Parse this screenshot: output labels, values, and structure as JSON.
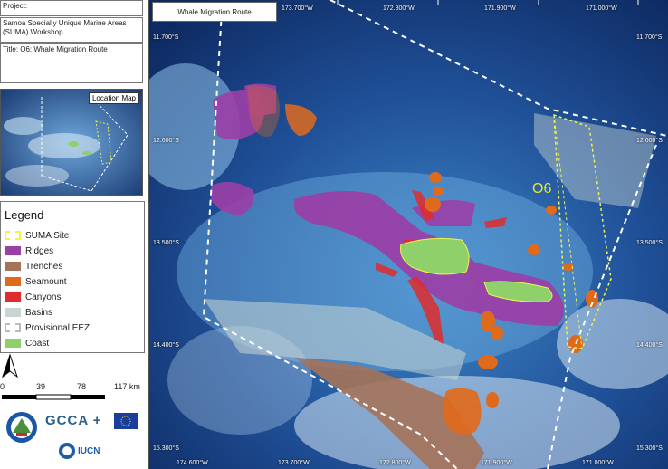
{
  "project_label": "Project:",
  "workshop": "Samoa Specially Unique Marine Areas (SUMA) Workshop",
  "title_label": "Title: O6: Whale Migration Route",
  "location_map_label": "Location Map",
  "legend": {
    "title": "Legend",
    "items": [
      {
        "label": "SUMA Site",
        "color": "#f2f24a",
        "style": "dashed"
      },
      {
        "label": "Ridges",
        "color": "#9b3fa6"
      },
      {
        "label": "Trenches",
        "color": "#a5735a"
      },
      {
        "label": "Seamount",
        "color": "#e06a1c"
      },
      {
        "label": "Canyons",
        "color": "#e02c2c"
      },
      {
        "label": "Basins",
        "color": "#c8d5d4"
      },
      {
        "label": "Provisional EEZ",
        "color": "#ffffff",
        "style": "dashed"
      },
      {
        "label": "Coast",
        "color": "#8fd06a"
      }
    ]
  },
  "scale": {
    "ticks": [
      "0",
      "39",
      "78",
      "117 km"
    ]
  },
  "logos": {
    "gcca": "GCCA +",
    "iucn": "IUCN"
  },
  "map": {
    "title": "Whale Migration Route",
    "site_label": "O6",
    "top_coords": [
      "173.700°W",
      "172.800°W",
      "171.900°W",
      "171.000°W"
    ],
    "bottom_coords": [
      "174.600°W",
      "173.700°W",
      "172.800°W",
      "171.900°W",
      "171.000°W"
    ],
    "left_coords": [
      "11.700°S",
      "12.600°S",
      "13.500°S",
      "14.400°S",
      "15.300°S"
    ],
    "right_coords": [
      "11.700°S",
      "12.600°S",
      "13.500°S",
      "14.400°S",
      "15.300°S"
    ]
  }
}
